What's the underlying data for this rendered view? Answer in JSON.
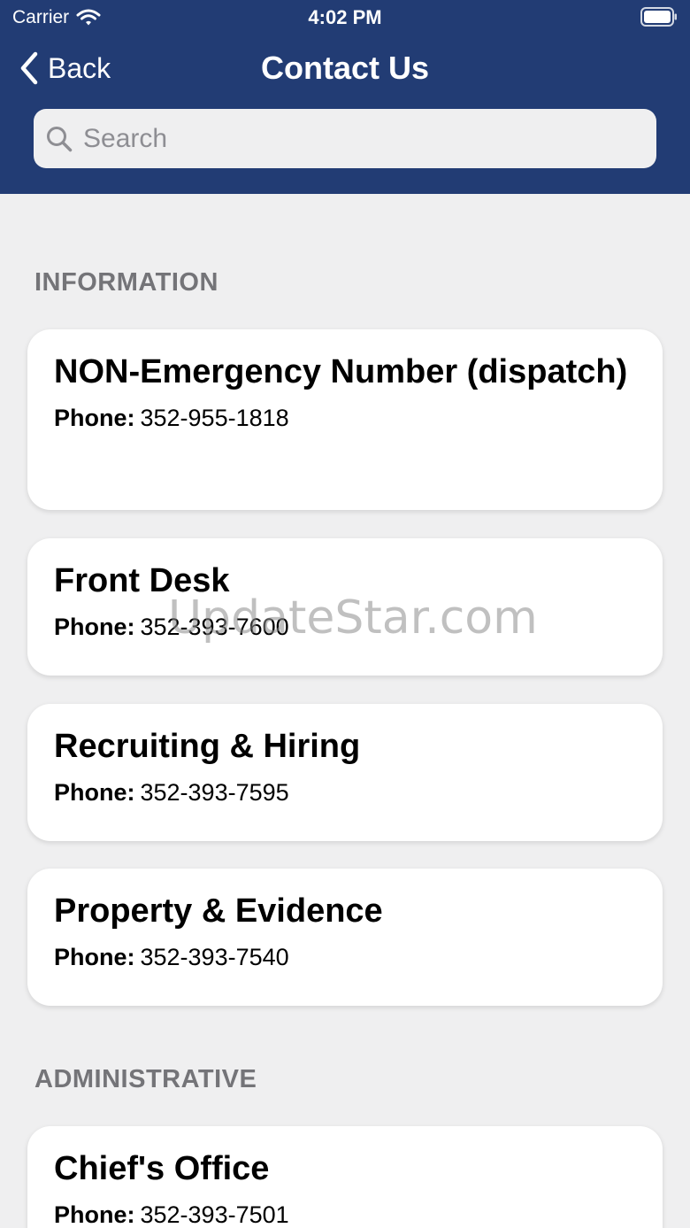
{
  "status_bar": {
    "carrier": "Carrier",
    "time": "4:02 PM"
  },
  "nav": {
    "back_label": "Back",
    "title": "Contact Us"
  },
  "search": {
    "placeholder": "Search",
    "value": ""
  },
  "sections": [
    {
      "header": "INFORMATION",
      "items": [
        {
          "title": "NON-Emergency Number (dispatch)",
          "phone_label": "Phone:",
          "phone": "352-955-1818"
        },
        {
          "title": "Front Desk",
          "phone_label": "Phone:",
          "phone": "352-393-7600"
        },
        {
          "title": "Recruiting & Hiring",
          "phone_label": "Phone:",
          "phone": "352-393-7595"
        },
        {
          "title": "Property & Evidence",
          "phone_label": "Phone:",
          "phone": "352-393-7540"
        }
      ]
    },
    {
      "header": "ADMINISTRATIVE",
      "items": [
        {
          "title": "Chief's Office",
          "phone_label": "Phone:",
          "phone": "352-393-7501"
        }
      ]
    }
  ],
  "watermark": "UpdateStar.com",
  "colors": {
    "header_bg": "#223c74",
    "page_bg": "#efeff0",
    "section_header": "#747478",
    "card_bg": "#ffffff"
  },
  "icons": [
    "wifi-icon",
    "battery-icon",
    "chevron-left-icon",
    "search-icon"
  ]
}
